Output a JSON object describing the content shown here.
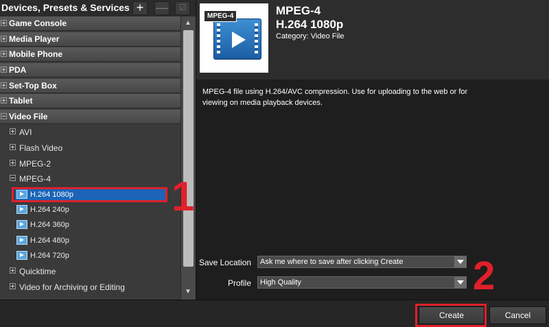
{
  "left_panel": {
    "title": "Devices, Presets & Services",
    "header_buttons": {
      "add": "+",
      "remove": "—",
      "edit": "☑"
    },
    "categories": [
      "Game Console",
      "Media Player",
      "Mobile Phone",
      "PDA",
      "Set-Top Box",
      "Tablet",
      "Video File"
    ],
    "video_file_children": {
      "before": [
        "AVI",
        "Flash Video",
        "MPEG-2"
      ],
      "expanded": "MPEG-4",
      "presets": [
        "H.264 1080p",
        "H.264 240p",
        "H.264 360p",
        "H.264 480p",
        "H.264 720p"
      ],
      "selected_preset": "H.264 1080p",
      "after": [
        "Quicktime",
        "Video for Archiving or Editing"
      ]
    }
  },
  "preset_info": {
    "badge": "MPEG-4",
    "title": "MPEG-4",
    "subtitle": "H.264 1080p",
    "category": "Category: Video File",
    "description": "MPEG-4 file using H.264/AVC compression. Use for uploading to the web or for viewing on media playback devices."
  },
  "settings": {
    "save_location_label": "Save Location",
    "save_location_value": "Ask me where to save after clicking Create",
    "profile_label": "Profile",
    "profile_value": "High Quality"
  },
  "buttons": {
    "create": "Create",
    "cancel": "Cancel"
  },
  "annotations": {
    "step1": "1",
    "step2": "2"
  },
  "colors": {
    "selection": "#1b64b8",
    "annotation": "#e0202a"
  }
}
